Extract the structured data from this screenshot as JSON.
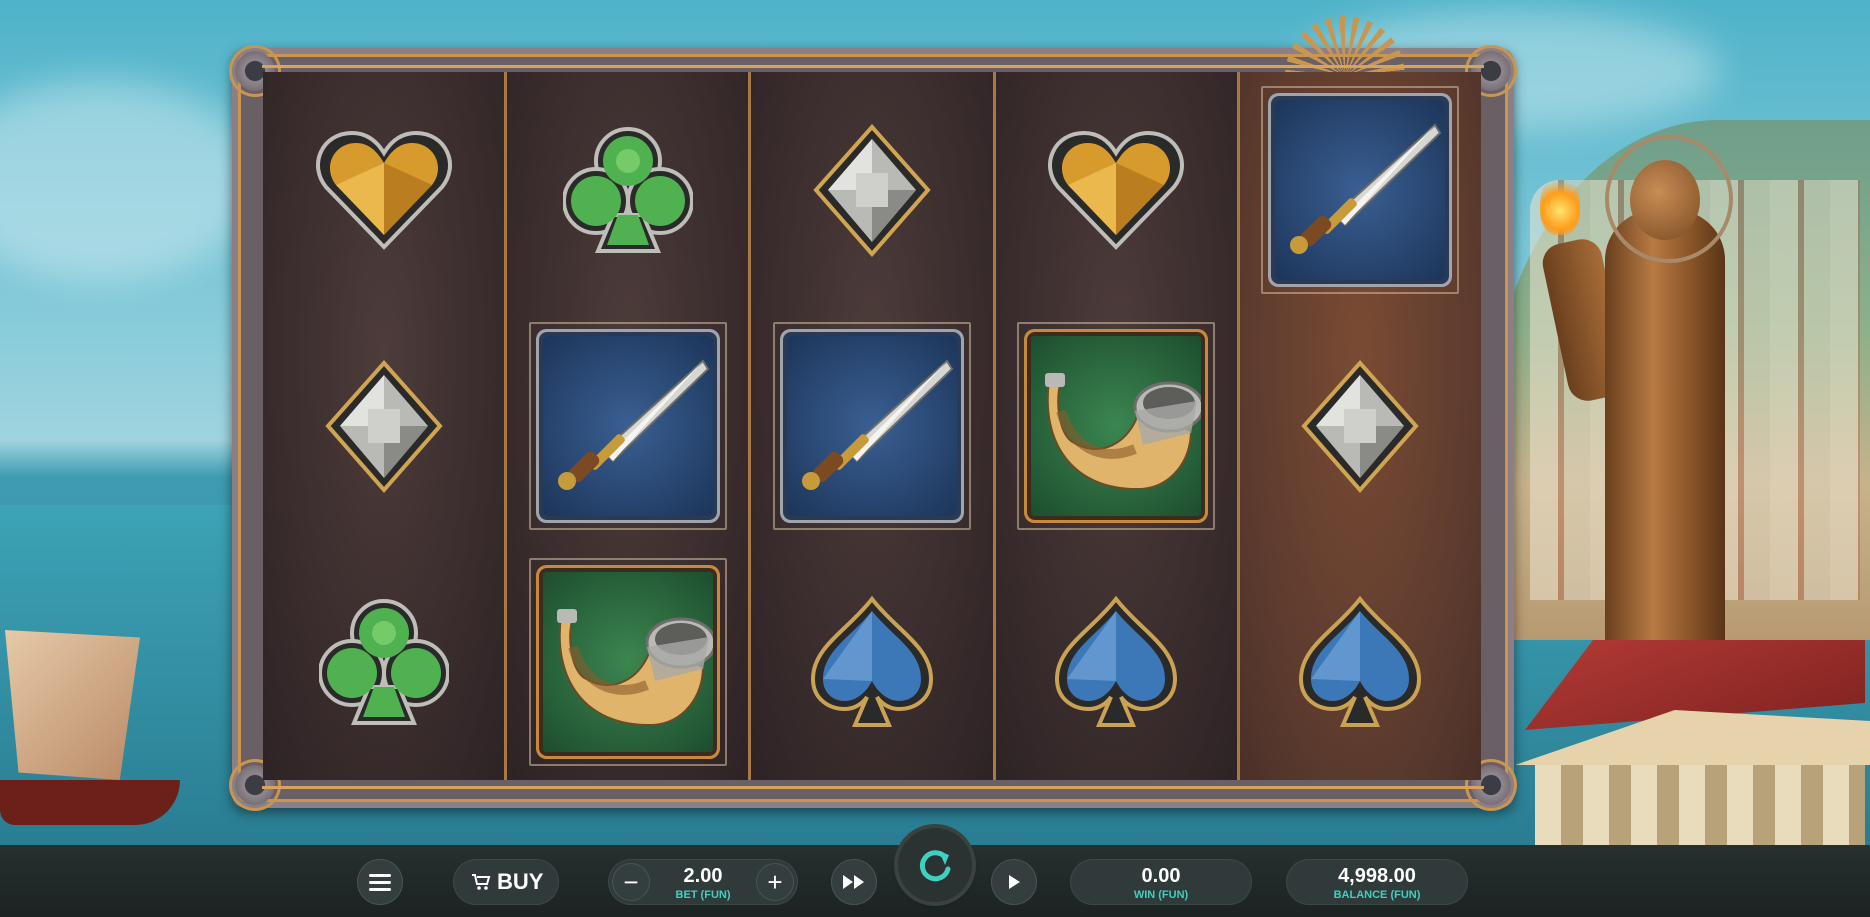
{
  "grid": {
    "reels": [
      [
        "heart-gold",
        "diamond-silver",
        "club-green"
      ],
      [
        "club-green",
        "sword-blue-tile",
        "horn-green-tile"
      ],
      [
        "diamond-silver",
        "sword-blue-tile",
        "spade-blue"
      ],
      [
        "heart-gold",
        "horn-green-tile",
        "spade-blue"
      ],
      [
        "sword-blue-tile",
        "diamond-silver",
        "spade-blue"
      ]
    ]
  },
  "controls": {
    "menu_icon": "hamburger-menu-icon",
    "buy_label": "BUY",
    "bet_value": "2.00",
    "bet_label": "BET (FUN)",
    "minus": "−",
    "plus": "+",
    "win_value": "0.00",
    "win_label": "WIN (FUN)",
    "balance_value": "4,998.00",
    "balance_label": "BALANCE (FUN)"
  },
  "colors": {
    "accent": "#3fd0c0",
    "frame_gold": "#c89650",
    "bar_bg": "#1f2827"
  }
}
